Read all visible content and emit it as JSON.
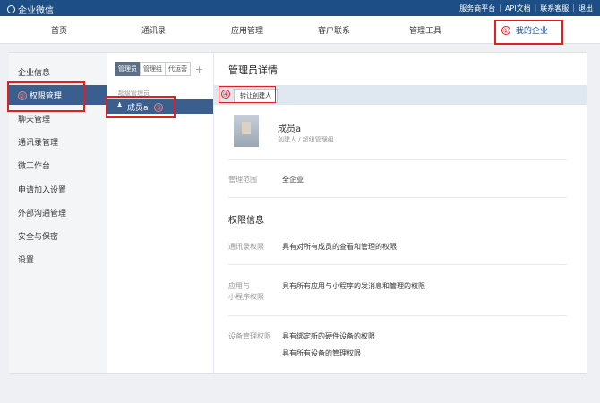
{
  "header": {
    "logo_text": "企业微信",
    "links": [
      "服务商平台",
      "API文档",
      "联系客服",
      "退出"
    ],
    "brand_color": "#1d4f86"
  },
  "nav": {
    "items": [
      "首页",
      "通讯录",
      "应用管理",
      "客户联系",
      "管理工具",
      "我的企业"
    ]
  },
  "annotations": [
    "①",
    "②",
    "③",
    "④"
  ],
  "sidebar": {
    "items": [
      "企业信息",
      "权限管理",
      "聊天管理",
      "通讯录管理",
      "微工作台",
      "申请加入设置",
      "外部沟通管理",
      "安全与保密",
      "设置"
    ],
    "active_index": 1
  },
  "middle": {
    "tabs": [
      "管理员",
      "管理组",
      "代运营"
    ],
    "plus": "+",
    "group_label": "超级管理员",
    "member_name": "成员a"
  },
  "detail": {
    "title": "管理员详情",
    "button": "转让创建人",
    "name": "成员a",
    "role": "创建人 / 超级管理组",
    "scope_label": "管理范围",
    "scope_value": "全企业",
    "section_title": "权限信息",
    "permissions": [
      {
        "label": "通讯录权限",
        "values": [
          "具有对所有成员的查看和管理的权限"
        ]
      },
      {
        "label": "应用与\n小程序权限",
        "values": [
          "具有所有应用与小程序的发消息和管理的权限"
        ]
      },
      {
        "label": "设备管理权限",
        "values": [
          "具有绑定新的硬件设备的权限",
          "具有所有设备的管理权限"
        ]
      }
    ]
  }
}
